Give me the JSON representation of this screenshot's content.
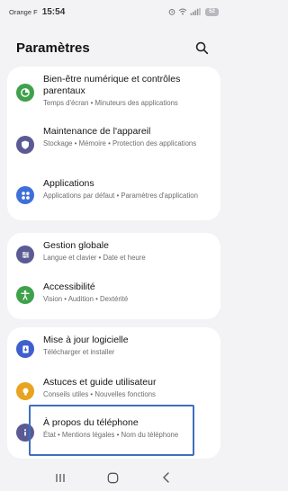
{
  "status_bar": {
    "carrier": "Orange F",
    "time": "15:54",
    "battery": "52",
    "icons": [
      "alarm-icon",
      "wifi-icon",
      "signal-icon"
    ]
  },
  "header": {
    "title": "Paramètres",
    "search_icon": "search-icon"
  },
  "groups": [
    {
      "items": [
        {
          "title": "Bien-être numérique et contrôles parentaux",
          "subtitle": "Temps d'écran  •  Minuteurs des applications",
          "icon": "wellbeing-icon",
          "color": "#3fa14b"
        },
        {
          "title": "Maintenance de l'appareil",
          "subtitle": "Stockage  •  Mémoire  •  Protection des applications",
          "icon": "device-care-icon",
          "color": "#5b5a93"
        },
        {
          "title": "Applications",
          "subtitle": "Applications par défaut  •  Paramètres d'application",
          "icon": "apps-icon",
          "color": "#3f6fd9"
        }
      ]
    },
    {
      "items": [
        {
          "title": "Gestion globale",
          "subtitle": "Langue et clavier  •  Date et heure",
          "icon": "general-management-icon",
          "color": "#5b5a93"
        },
        {
          "title": "Accessibilité",
          "subtitle": "Vision  •  Audition  •  Dextérité",
          "icon": "accessibility-icon",
          "color": "#3fa14b"
        }
      ]
    },
    {
      "items": [
        {
          "title": "Mise à jour logicielle",
          "subtitle": "Télécharger et installer",
          "icon": "software-update-icon",
          "color": "#3f5fcf"
        },
        {
          "title": "Astuces et guide utilisateur",
          "subtitle": "Conseils utiles  •  Nouvelles fonctions",
          "icon": "tips-icon",
          "color": "#e8a321"
        },
        {
          "title": "À propos du téléphone",
          "subtitle": "État  •  Mentions légales  •  Nom du téléphone",
          "icon": "about-phone-icon",
          "color": "#5b5a93"
        }
      ]
    }
  ],
  "navbar": {
    "icons": [
      "recents-icon",
      "home-icon",
      "back-icon"
    ]
  }
}
